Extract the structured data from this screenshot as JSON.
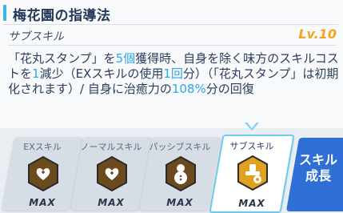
{
  "skill": {
    "title": "梅花園の指導法",
    "type_label": "サブスキル",
    "level": "Lv.10",
    "description": {
      "t1": "「花丸スタンプ」を",
      "n1": "5個",
      "t2": "獲得時、自身を除く味方のスキルコストを",
      "n2": "1",
      "t3": "減少（EXスキルの使用",
      "n3": "1回",
      "t4": "分）（「花丸スタンプ」は初期化されます）/ 自身に治癒力の",
      "n4": "108%",
      "t5": "分の回復"
    }
  },
  "tabs": [
    {
      "label": "EXスキル",
      "badge": "MAX",
      "icon": "heart-hands-icon"
    },
    {
      "label": "ノーマルスキル",
      "badge": "MAX",
      "icon": "heart-plus-icon"
    },
    {
      "label": "パッシブスキル",
      "badge": "MAX",
      "icon": "snowman-icon"
    },
    {
      "label": "サブスキル",
      "badge": "MAX",
      "icon": "flower-stamp-icon"
    }
  ],
  "growth_button": {
    "line1": "スキル",
    "line2": "成長"
  },
  "colors": {
    "accent": "#3eb1e8",
    "level": "#f2a51e",
    "highlight": "#2fa6e6",
    "growth_button": "#2f6fd6",
    "hex_inactive": "#6b4a1e",
    "hex_active": "#e0a11e"
  }
}
